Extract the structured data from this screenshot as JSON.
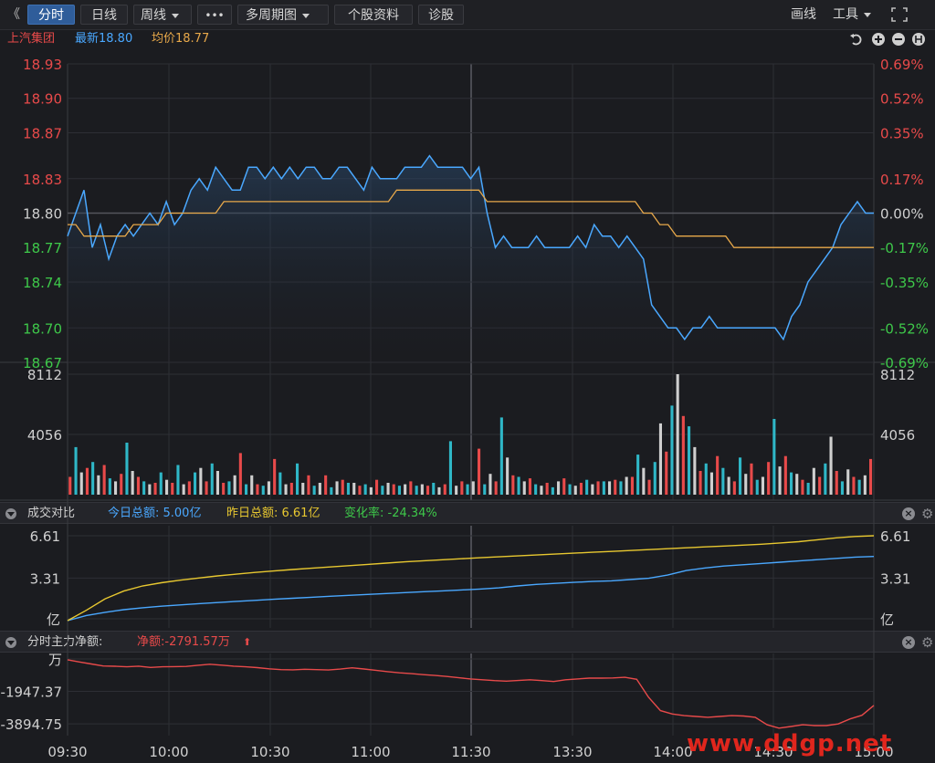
{
  "toolbar": {
    "collapse_glyph": "《",
    "tabs": [
      "分时",
      "日线",
      "周线",
      "多周期图",
      "个股资料",
      "诊股"
    ],
    "more_glyph": "•••",
    "draw_label": "画线",
    "tools_label": "工具",
    "fullscreen_icon": "fullscreen-icon"
  },
  "info": {
    "name": "上汽集团",
    "latest": "最新18.80",
    "avg": "均价18.77",
    "colors": {
      "name": "#e84a4a",
      "latest": "#4aa8ff",
      "avg": "#e8a94a"
    }
  },
  "panel1": {
    "title": "成交对比",
    "today": "今日总额: 5.00亿",
    "yesterday": "昨日总额: 6.61亿",
    "change": "变化率: -24.34%"
  },
  "panel2": {
    "title": "分时主力净额:",
    "net": "净额:-2791.57万",
    "arrow": "⬆"
  },
  "watermark": "www.ddgp.net",
  "chart_data": [
    {
      "type": "line",
      "name": "price",
      "x_ticks": [
        "09:30",
        "10:00",
        "10:30",
        "11:00",
        "11:30",
        "13:30",
        "14:00",
        "14:30",
        "15:00"
      ],
      "y_ticks_left": [
        "18.93",
        "18.90",
        "18.87",
        "18.83",
        "18.80",
        "18.77",
        "18.74",
        "18.70",
        "18.67"
      ],
      "y_ticks_right": [
        "0.69%",
        "0.52%",
        "0.35%",
        "0.17%",
        "0.00%",
        "-0.17%",
        "-0.35%",
        "-0.52%",
        "-0.69%"
      ],
      "ylim": [
        18.67,
        18.93
      ],
      "prev_close": 18.8,
      "series": [
        {
          "name": "最新",
          "color": "#4aa8ff",
          "values": [
            18.78,
            18.8,
            18.82,
            18.77,
            18.79,
            18.76,
            18.78,
            18.79,
            18.78,
            18.79,
            18.8,
            18.79,
            18.81,
            18.79,
            18.8,
            18.82,
            18.83,
            18.82,
            18.84,
            18.83,
            18.82,
            18.82,
            18.84,
            18.84,
            18.83,
            18.84,
            18.83,
            18.84,
            18.83,
            18.84,
            18.84,
            18.83,
            18.83,
            18.84,
            18.84,
            18.83,
            18.82,
            18.84,
            18.83,
            18.83,
            18.83,
            18.84,
            18.84,
            18.84,
            18.85,
            18.84,
            18.84,
            18.84,
            18.84,
            18.83,
            18.84,
            18.8,
            18.77,
            18.78,
            18.77,
            18.77,
            18.77,
            18.78,
            18.77,
            18.77,
            18.77,
            18.77,
            18.78,
            18.77,
            18.79,
            18.78,
            18.78,
            18.77,
            18.78,
            18.77,
            18.76,
            18.72,
            18.71,
            18.7,
            18.7,
            18.69,
            18.7,
            18.7,
            18.71,
            18.7,
            18.7,
            18.7,
            18.7,
            18.7,
            18.7,
            18.7,
            18.7,
            18.69,
            18.71,
            18.72,
            18.74,
            18.75,
            18.76,
            18.77,
            18.79,
            18.8,
            18.81,
            18.8,
            18.8
          ]
        },
        {
          "name": "均价",
          "color": "#e8a94a",
          "values": [
            18.79,
            18.79,
            18.78,
            18.78,
            18.78,
            18.78,
            18.78,
            18.78,
            18.79,
            18.79,
            18.79,
            18.79,
            18.8,
            18.8,
            18.8,
            18.8,
            18.8,
            18.8,
            18.8,
            18.81,
            18.81,
            18.81,
            18.81,
            18.81,
            18.81,
            18.81,
            18.81,
            18.81,
            18.81,
            18.81,
            18.81,
            18.81,
            18.81,
            18.81,
            18.81,
            18.81,
            18.81,
            18.81,
            18.81,
            18.81,
            18.82,
            18.82,
            18.82,
            18.82,
            18.82,
            18.82,
            18.82,
            18.82,
            18.82,
            18.82,
            18.82,
            18.81,
            18.81,
            18.81,
            18.81,
            18.81,
            18.81,
            18.81,
            18.81,
            18.81,
            18.81,
            18.81,
            18.81,
            18.81,
            18.81,
            18.81,
            18.81,
            18.81,
            18.81,
            18.81,
            18.8,
            18.8,
            18.79,
            18.79,
            18.78,
            18.78,
            18.78,
            18.78,
            18.78,
            18.78,
            18.78,
            18.77,
            18.77,
            18.77,
            18.77,
            18.77,
            18.77,
            18.77,
            18.77,
            18.77,
            18.77,
            18.77,
            18.77,
            18.77,
            18.77,
            18.77,
            18.77,
            18.77,
            18.77
          ]
        }
      ]
    },
    {
      "type": "bar",
      "name": "volume",
      "y_ticks": [
        "8112",
        "4056"
      ],
      "ylim": [
        0,
        8112
      ],
      "values": [
        1200,
        3200,
        1500,
        1800,
        2200,
        1300,
        2000,
        1100,
        900,
        1400,
        3500,
        1600,
        1200,
        900,
        700,
        800,
        1500,
        1000,
        800,
        2000,
        700,
        900,
        1500,
        1800,
        900,
        2100,
        1600,
        800,
        900,
        1300,
        2800,
        700,
        1300,
        700,
        600,
        900,
        2400,
        1500,
        700,
        800,
        2100,
        800,
        1300,
        600,
        800,
        1300,
        500,
        900,
        1000,
        800,
        800,
        600,
        700,
        500,
        1000,
        600,
        800,
        700,
        600,
        700,
        900,
        600,
        700,
        600,
        800,
        500,
        700,
        3600,
        600,
        900,
        700,
        900,
        3100,
        700,
        1400,
        900,
        5200,
        2500,
        1300,
        1200,
        900,
        1100,
        700,
        600,
        800,
        500,
        900,
        1100,
        700,
        600,
        800,
        1000,
        700,
        900,
        900,
        900,
        1000,
        900,
        1200,
        1200,
        2700,
        1800,
        1000,
        2200,
        4800,
        2900,
        6000,
        8112,
        5300,
        4600,
        3200,
        1600,
        2100,
        1500,
        2600,
        1800,
        1200,
        900,
        2500,
        1400,
        2100,
        1000,
        1200,
        2200,
        5100,
        1900,
        2600,
        1500,
        1400,
        1000,
        800,
        1800,
        1200,
        2100,
        3900,
        1600,
        900,
        1700,
        1200,
        1000,
        1300,
        2400
      ],
      "colors": [
        "#e84a4a",
        "#2fb7c7",
        "#cfcfcf"
      ]
    },
    {
      "type": "line",
      "name": "成交对比",
      "y_ticks": [
        "6.61",
        "3.31",
        "亿"
      ],
      "ylim": [
        0,
        6.61
      ],
      "series": [
        {
          "name": "今日总额",
          "color": "#4aa8ff",
          "values": [
            0,
            0.4,
            0.65,
            0.85,
            1.0,
            1.12,
            1.22,
            1.32,
            1.41,
            1.5,
            1.58,
            1.66,
            1.74,
            1.82,
            1.9,
            1.97,
            2.04,
            2.11,
            2.18,
            2.25,
            2.32,
            2.39,
            2.46,
            2.55,
            2.7,
            2.82,
            2.9,
            2.98,
            3.05,
            3.1,
            3.2,
            3.3,
            3.55,
            3.9,
            4.1,
            4.25,
            4.35,
            4.45,
            4.55,
            4.65,
            4.75,
            4.85,
            4.95,
            5.0
          ]
        },
        {
          "name": "昨日总额",
          "color": "#e8c830",
          "values": [
            0,
            0.8,
            1.7,
            2.3,
            2.7,
            2.95,
            3.15,
            3.32,
            3.48,
            3.62,
            3.75,
            3.87,
            3.98,
            4.08,
            4.18,
            4.28,
            4.38,
            4.48,
            4.58,
            4.66,
            4.74,
            4.82,
            4.9,
            4.97,
            5.04,
            5.11,
            5.18,
            5.25,
            5.32,
            5.39,
            5.46,
            5.53,
            5.6,
            5.67,
            5.74,
            5.81,
            5.88,
            5.95,
            6.05,
            6.15,
            6.3,
            6.45,
            6.55,
            6.61
          ]
        }
      ]
    },
    {
      "type": "line",
      "name": "分时主力净额",
      "y_ticks": [
        "万",
        "-1947.37",
        "-3894.75"
      ],
      "ylim": [
        -4600,
        0
      ],
      "series": [
        {
          "name": "净额",
          "color": "#e84a4a",
          "values": [
            -50,
            -180,
            -300,
            -420,
            -440,
            -470,
            -430,
            -510,
            -470,
            -460,
            -450,
            -380,
            -320,
            -370,
            -430,
            -470,
            -520,
            -590,
            -640,
            -650,
            -620,
            -640,
            -660,
            -610,
            -530,
            -600,
            -680,
            -760,
            -830,
            -880,
            -940,
            -990,
            -1050,
            -1130,
            -1200,
            -1250,
            -1300,
            -1330,
            -1290,
            -1250,
            -1300,
            -1350,
            -1250,
            -1200,
            -1150,
            -1150,
            -1140,
            -1100,
            -1220,
            -2300,
            -3100,
            -3300,
            -3400,
            -3450,
            -3500,
            -3450,
            -3400,
            -3420,
            -3500,
            -3950,
            -4150,
            -4050,
            -3950,
            -4000,
            -4000,
            -3900,
            -3600,
            -3380,
            -2790
          ]
        }
      ]
    }
  ]
}
